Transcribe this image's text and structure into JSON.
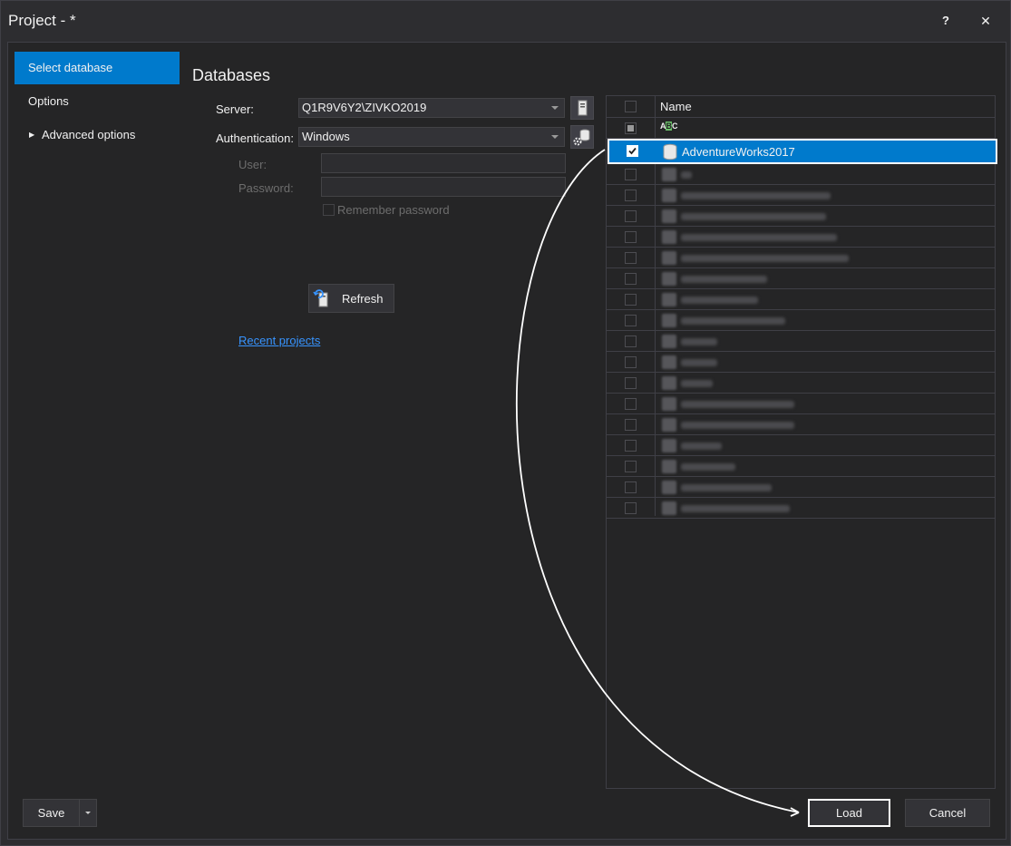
{
  "window": {
    "title": "Project - *",
    "help_label": "?",
    "close_label": "✕"
  },
  "sidebar": {
    "items": [
      {
        "label": "Select database"
      },
      {
        "label": "Options"
      },
      {
        "label": "Advanced options"
      }
    ]
  },
  "main": {
    "heading": "Databases",
    "server_label": "Server:",
    "server_value": "Q1R9V6Y2\\ZIVKO2019",
    "auth_label": "Authentication:",
    "auth_value": "Windows",
    "user_label": "User:",
    "password_label": "Password:",
    "remember_label": "Remember password",
    "refresh_label": "Refresh",
    "recent_projects_label": "Recent projects"
  },
  "grid": {
    "name_header": "Name",
    "filter_icon_text": "ABC",
    "selected_row": {
      "name": "AdventureWorks2017",
      "checked": true
    }
  },
  "footer": {
    "save_label": "Save",
    "load_label": "Load",
    "cancel_label": "Cancel"
  },
  "colors": {
    "accent": "#007acc",
    "background": "#2d2d30",
    "panel": "#252526",
    "link": "#3794ff"
  }
}
